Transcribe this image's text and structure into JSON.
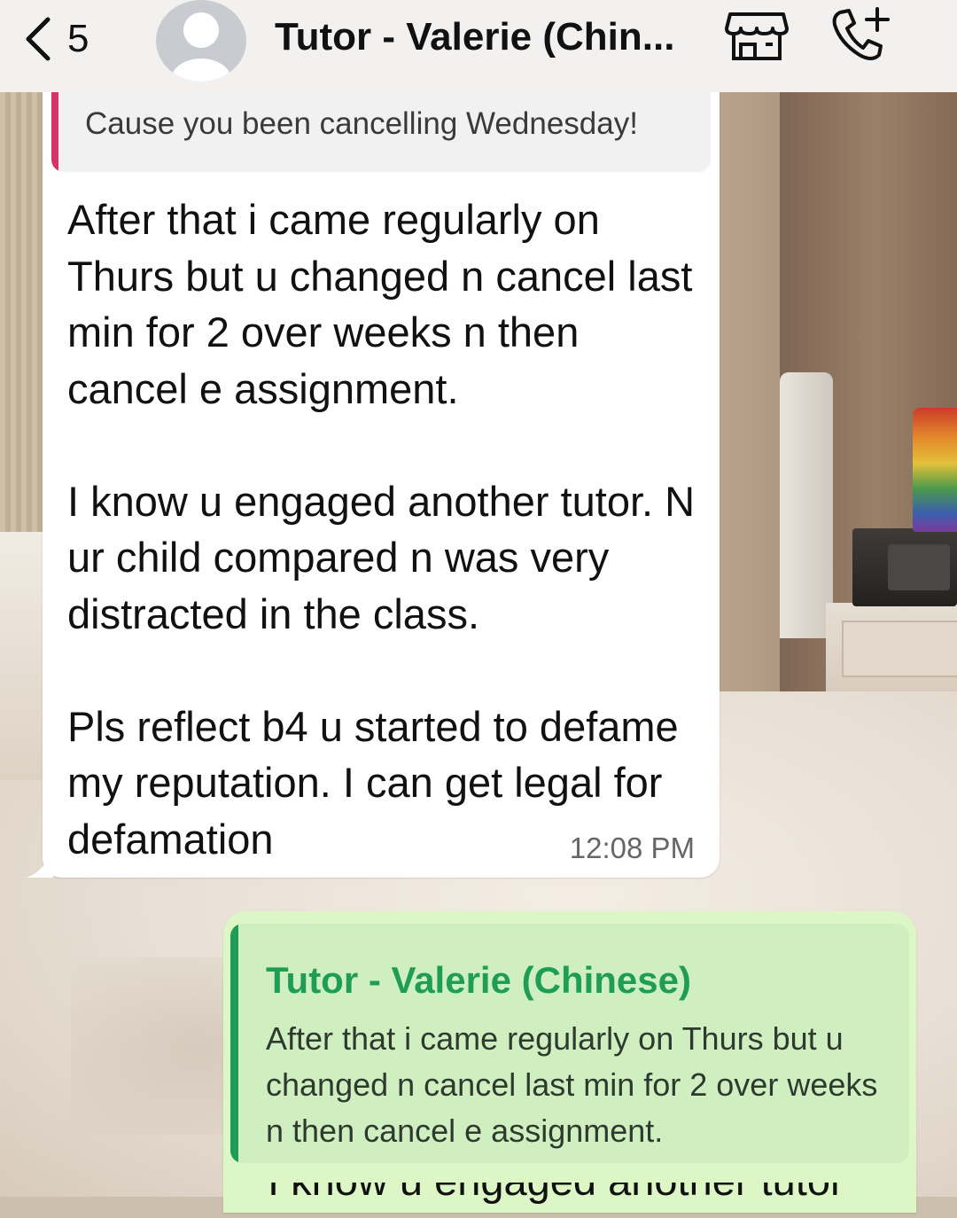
{
  "header": {
    "back_count": "5",
    "title": "Tutor - Valerie (Chin..."
  },
  "incoming": {
    "quote_text": "Cause you been cancelling Wednesday!",
    "paragraphs": [
      "After that i came regularly on Thurs but u changed n cancel last min for 2 over weeks n then cancel e assignment.",
      "I know u engaged another tutor. N ur child compared n was very distracted in the class.",
      "Pls reflect b4 u started to defame my reputation. I can get legal for defamation"
    ],
    "time": "12:08 PM"
  },
  "outgoing": {
    "quote_author": "Tutor - Valerie (Chinese)",
    "quote_text": "After that i came regularly on Thurs but u changed n cancel last min for 2 over weeks n then cancel e assignment.",
    "partial_text": "I know u engaged another tutor"
  },
  "colors": {
    "header_bg": "#f2f1ef",
    "incoming_bubble": "#ffffff",
    "outgoing_bubble": "#dcf7c5",
    "incoming_quote_bar": "#d6336c",
    "outgoing_quote_bar": "#1f9d55"
  },
  "icons": {
    "back": "chevron-left-icon",
    "avatar": "person-silhouette-icon",
    "store": "storefront-icon",
    "call": "phone-add-icon"
  }
}
